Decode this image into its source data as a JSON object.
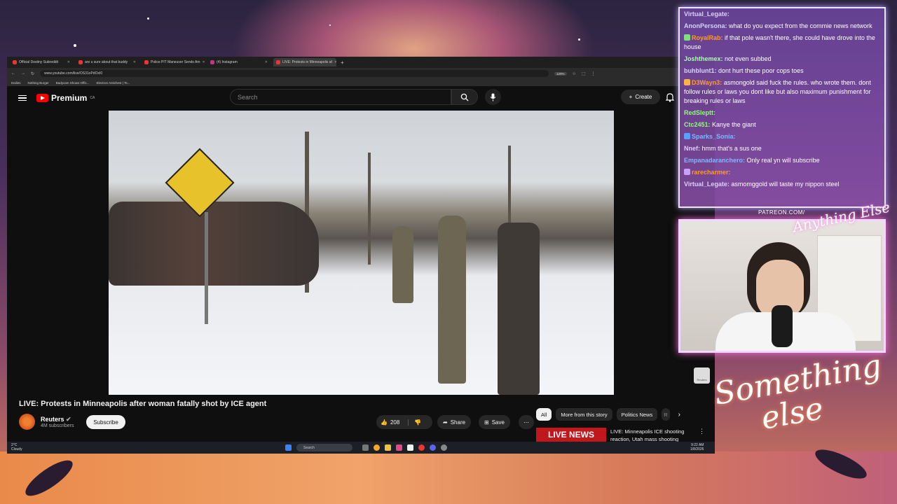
{
  "browser": {
    "tabs": [
      {
        "label": "Official Destiny Subreddit"
      },
      {
        "label": "are u sure about that buddy"
      },
      {
        "label": "Police PIT Maneuver Sends Am"
      },
      {
        "label": "(4) Instagram"
      },
      {
        "label": "LIVE: Protests in Minneapolis af"
      }
    ],
    "url": "www.youtube.com/live/OS31oPdOxI0",
    "zoom": "120%",
    "bookmarks": [
      "Dailies",
      "Nothing Burger",
      "Badycam Shows Offic...",
      "Electron Antichest | Ts..."
    ]
  },
  "youtube": {
    "logo_text": "Premium",
    "logo_region": "CA",
    "search_placeholder": "Search",
    "create_label": "Create",
    "video_title": "LIVE: Protests in Minneapolis after woman fatally shot by ICE agent",
    "watermark": "Reuters",
    "channel": {
      "name": "Reuters",
      "subscribers": "4M subscribers",
      "subscribe_label": "Subscribe"
    },
    "actions": {
      "likes": "208",
      "share": "Share",
      "save": "Save"
    },
    "chips": [
      "All",
      "More from this story",
      "Politics News",
      "R"
    ],
    "recommended": {
      "thumb_text": "LIVE NEWS",
      "title": "LIVE: Minneapolis ICE shooting reaction, Utah mass shooting"
    }
  },
  "taskbar": {
    "weather_temp": "2°C",
    "weather_desc": "Cloudy",
    "search_placeholder": "Search",
    "time": "9:22 AM",
    "date": "1/8/2026"
  },
  "chat": {
    "messages": [
      {
        "user": "Virtual_Legate:",
        "text": "",
        "color": "#d8d0ff"
      },
      {
        "user": "AnonPersona:",
        "text": "what do you expect from the commie news network",
        "color": "#d8d0ff"
      },
      {
        "user": "RoyalRab:",
        "text": "if that pole wasn't there, she could have drove into the house",
        "color": "#ff9a2e"
      },
      {
        "user": "Joshthemex:",
        "text": "not even subbed",
        "color": "#a8ffb0"
      },
      {
        "user": "buhblunt1:",
        "text": "dont hurt these poor cops toes",
        "color": "#d8d0ff"
      },
      {
        "user": "D3Wayn3:",
        "text": "asmongold said fuck the rules. who wrote them. dont follow rules or laws you dont like but also maximum punishment for breaking rules or laws",
        "color": "#ff9a2e"
      },
      {
        "user": "RedSleptt:",
        "text": "",
        "color": "#8cff7a"
      },
      {
        "user": "Ctc2451:",
        "text": "Kanye the giant",
        "color": "#8cff7a"
      },
      {
        "user": "Sparks_Sonia:",
        "text": "",
        "color": "#7fb8ff"
      },
      {
        "user": "Nnef:",
        "text": "hmm that's a sus one",
        "color": "#d8d0ff"
      },
      {
        "user": "Empanadaranchero:",
        "text": "Only real yn will subscribe",
        "color": "#7fb8ff"
      },
      {
        "user": "rarecharmer:",
        "text": "",
        "color": "#ff9a2e"
      },
      {
        "user": "Virtual_Legate:",
        "text": "asmomggold will taste my nippon steel",
        "color": "#d8d0ff"
      }
    ],
    "patreon": "PATREON.COM/",
    "cam_logo": "Anything Else",
    "brand_line1": "Something",
    "brand_line2": "else"
  }
}
